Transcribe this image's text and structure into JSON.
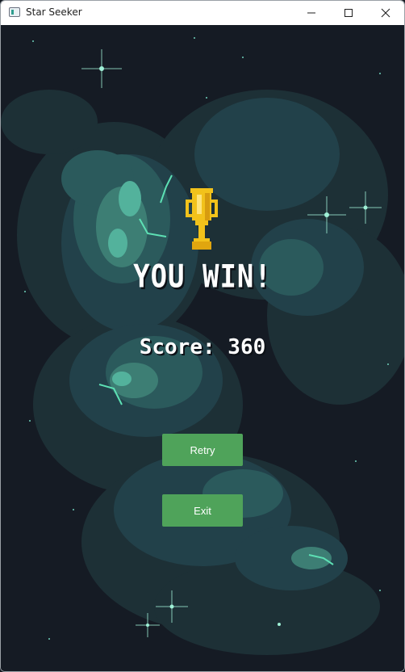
{
  "window": {
    "title": "Star Seeker",
    "controls": [
      "minimize",
      "maximize",
      "close"
    ]
  },
  "result": {
    "title": "YOU WIN!",
    "score_label": "Score: ",
    "score_value": "360",
    "icon": "trophy-icon"
  },
  "buttons": {
    "retry_label": "Retry",
    "exit_label": "Exit"
  },
  "colors": {
    "button": "#4fa35a",
    "background": "#151b24",
    "trophy": "#f2c21b",
    "nebula": "#2f9e8f"
  }
}
